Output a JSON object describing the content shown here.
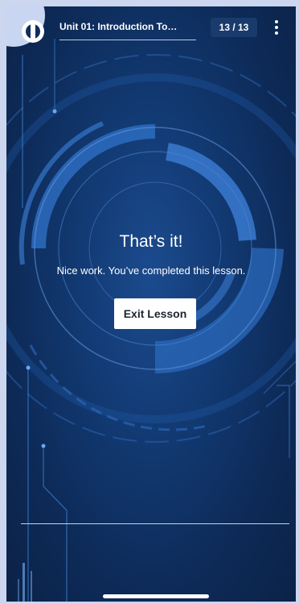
{
  "header": {
    "unit_title": "Unit 01: Introduction To…",
    "page_counter": "13 / 13",
    "more_icon": "more-vertical-icon",
    "logo_icon": "app-logo-icon"
  },
  "completion": {
    "title": "That’s it!",
    "message": "Nice work. You’ve completed this lesson.",
    "exit_label": "Exit Lesson"
  },
  "colors": {
    "accent": "#2f72c4",
    "background": "#0f2e5f",
    "button_background": "#ffffff"
  }
}
